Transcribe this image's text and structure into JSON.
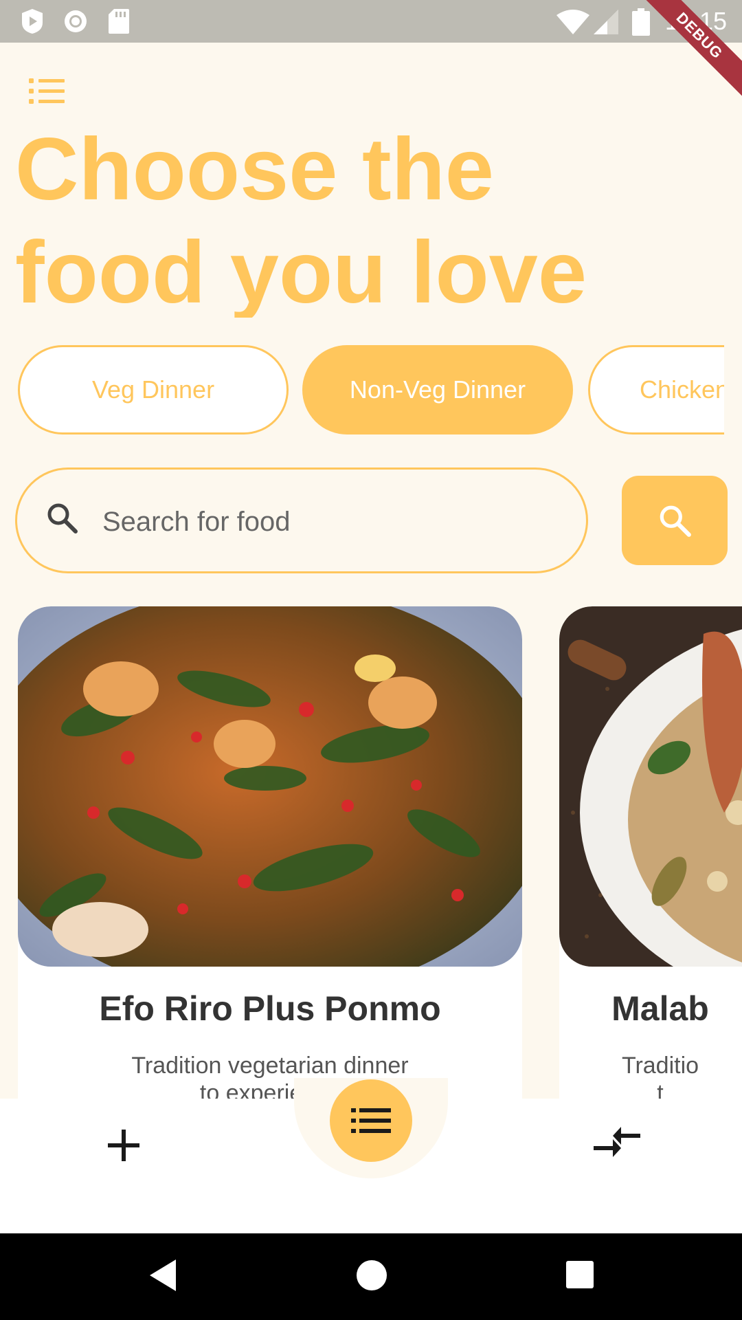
{
  "status_bar": {
    "time": "12:15",
    "debug_banner": "DEBUG",
    "left_icons": [
      "play-protect-icon",
      "record-icon",
      "sd-card-icon"
    ],
    "right_icons": [
      "wifi-icon",
      "signal-icon",
      "battery-icon"
    ]
  },
  "header": {
    "menu_icon": "list-icon",
    "headline_line1": "Choose the",
    "headline_line2": "food you love"
  },
  "categories": {
    "items": [
      {
        "label": "Veg Dinner",
        "active": false
      },
      {
        "label": "Non-Veg Dinner",
        "active": true
      },
      {
        "label": "Chicken",
        "active": false
      }
    ]
  },
  "search": {
    "placeholder": "Search for food",
    "value": "",
    "field_icon": "search-icon",
    "button_icon": "search-icon"
  },
  "food_cards": [
    {
      "title": "Efo Riro Plus Ponmo",
      "description_line1": "Tradition vegetarian dinner",
      "description_line2": "to experience"
    },
    {
      "title": "Malab",
      "description_line1": "Traditio",
      "description_line2": "t"
    }
  ],
  "bottom_nav": {
    "left_icon": "add-icon",
    "center_icon": "list-icon",
    "right_icon": "compare-arrows-icon"
  },
  "system_nav": {
    "back_icon": "back-triangle-icon",
    "home_icon": "home-circle-icon",
    "recents_icon": "recents-square-icon"
  },
  "colors": {
    "accent": "#ffc65c",
    "background": "#fdf8ee",
    "status_bar": "#bdbbb3",
    "debug_ribbon": "#a8343f",
    "title_text": "#333333",
    "nav_background": "#ffffff"
  }
}
